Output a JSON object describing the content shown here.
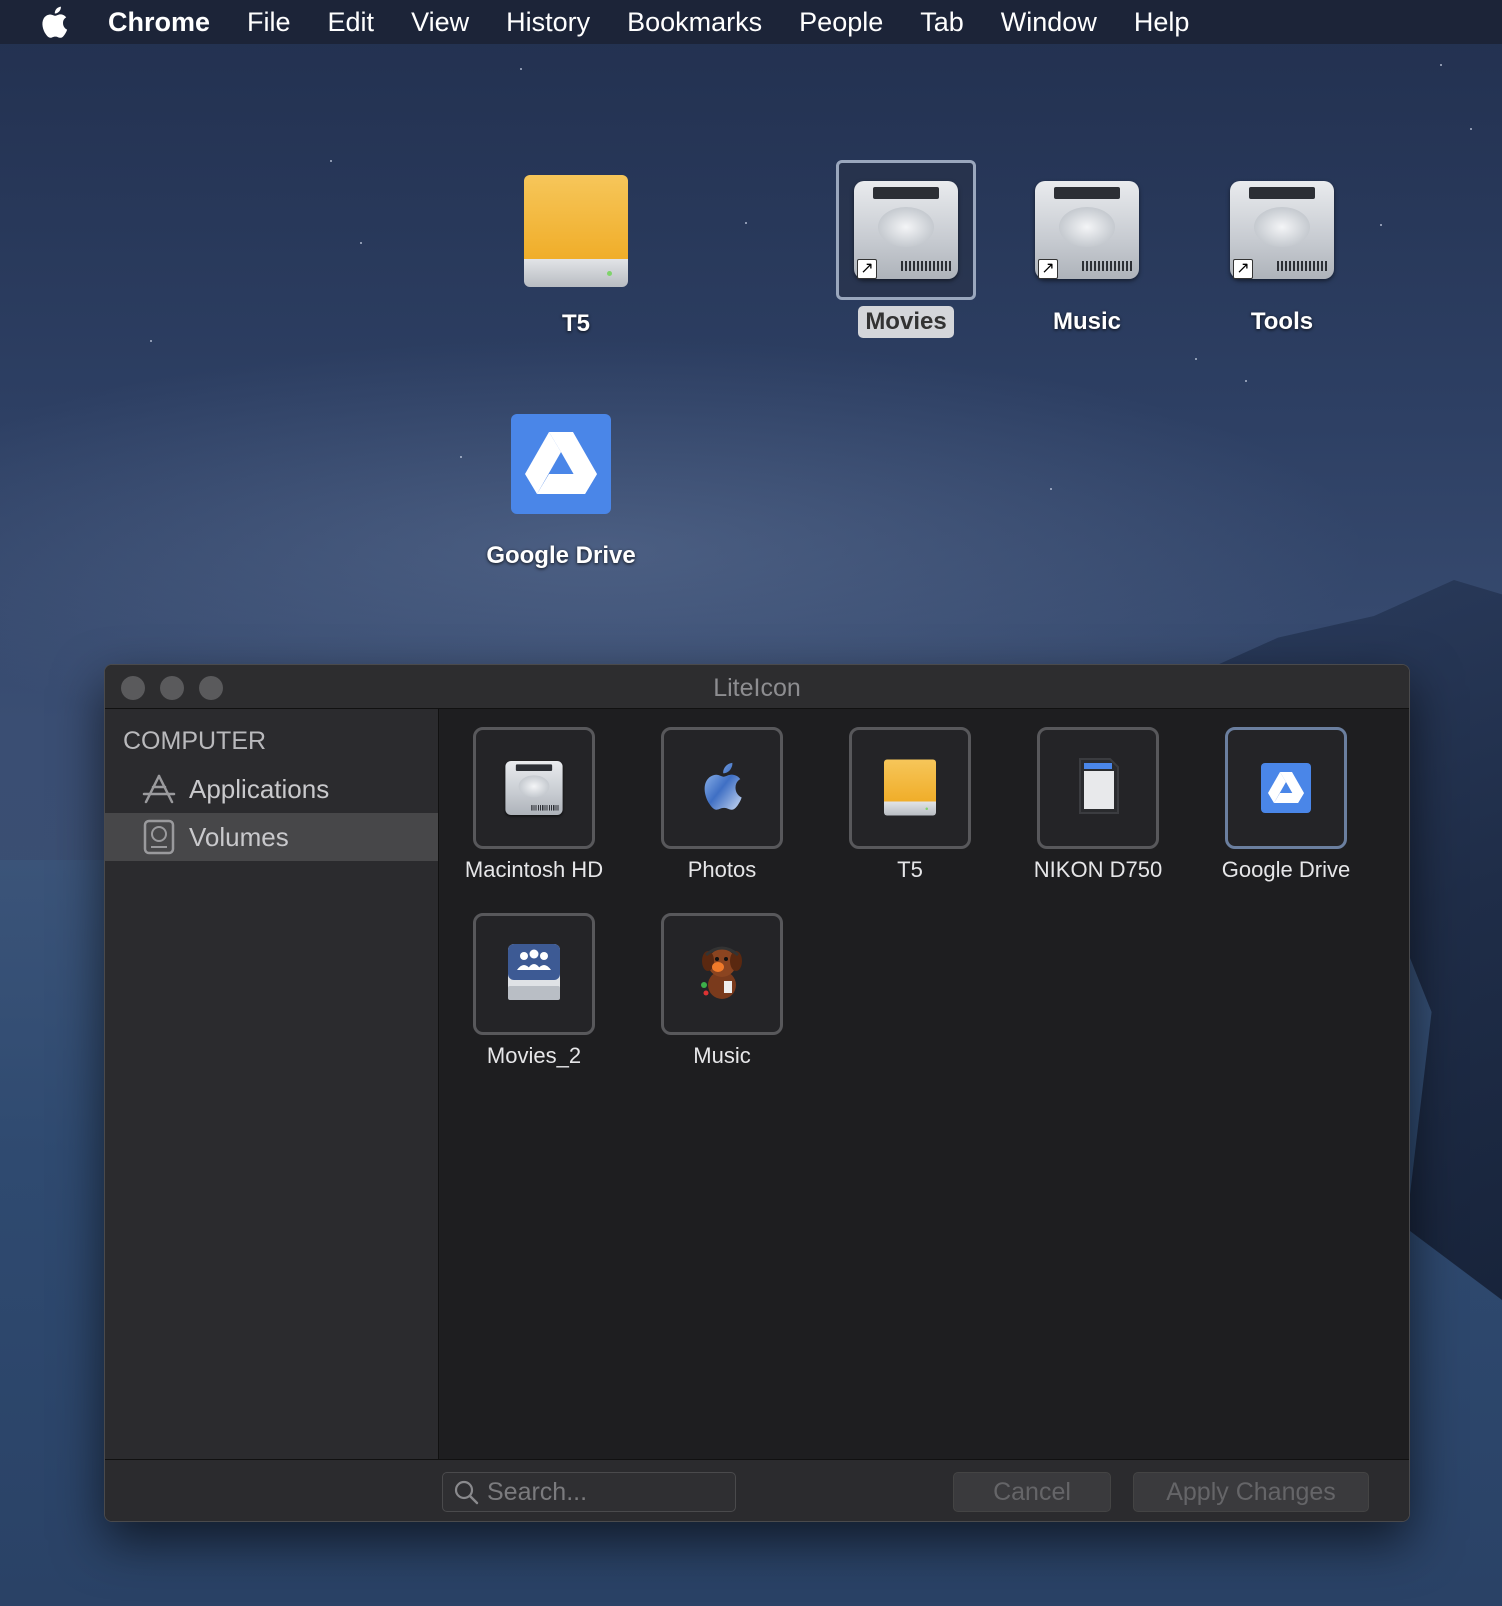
{
  "menubar": {
    "app_name": "Chrome",
    "items": [
      "File",
      "Edit",
      "View",
      "History",
      "Bookmarks",
      "People",
      "Tab",
      "Window",
      "Help"
    ]
  },
  "desktop": {
    "icons": [
      {
        "label": "T5",
        "icon": "external-drive-icon"
      },
      {
        "label": "Movies",
        "icon": "hard-drive-alias-icon",
        "selected": true
      },
      {
        "label": "Music",
        "icon": "hard-drive-alias-icon"
      },
      {
        "label": "Tools",
        "icon": "hard-drive-alias-icon"
      },
      {
        "label": "Google Drive",
        "icon": "google-drive-icon"
      }
    ]
  },
  "window": {
    "title": "LiteIcon",
    "sidebar": {
      "section": "COMPUTER",
      "items": [
        {
          "label": "Applications",
          "icon": "applications-icon"
        },
        {
          "label": "Volumes",
          "icon": "volumes-icon",
          "active": true
        }
      ]
    },
    "volumes": [
      {
        "name": "Macintosh HD",
        "icon": "hard-drive-icon"
      },
      {
        "name": "Photos",
        "icon": "apple-logo-icon"
      },
      {
        "name": "T5",
        "icon": "external-drive-icon"
      },
      {
        "name": "NIKON D750",
        "icon": "sd-card-icon"
      },
      {
        "name": "Google Drive",
        "icon": "google-drive-icon",
        "selected": true
      },
      {
        "name": "Movies_2",
        "icon": "shared-drive-icon"
      },
      {
        "name": "Music",
        "icon": "dog-mascot-icon"
      }
    ],
    "footer": {
      "search_placeholder": "Search...",
      "cancel_label": "Cancel",
      "apply_label": "Apply Changes"
    }
  },
  "colors": {
    "menubar_bg": "#1c2438",
    "window_bg": "#1f1f21",
    "sidebar_bg": "#2b2b2e",
    "selection_border": "#6b7f9f",
    "google_drive_blue": "#4a86e8",
    "drive_orange": "#f0ad28"
  }
}
